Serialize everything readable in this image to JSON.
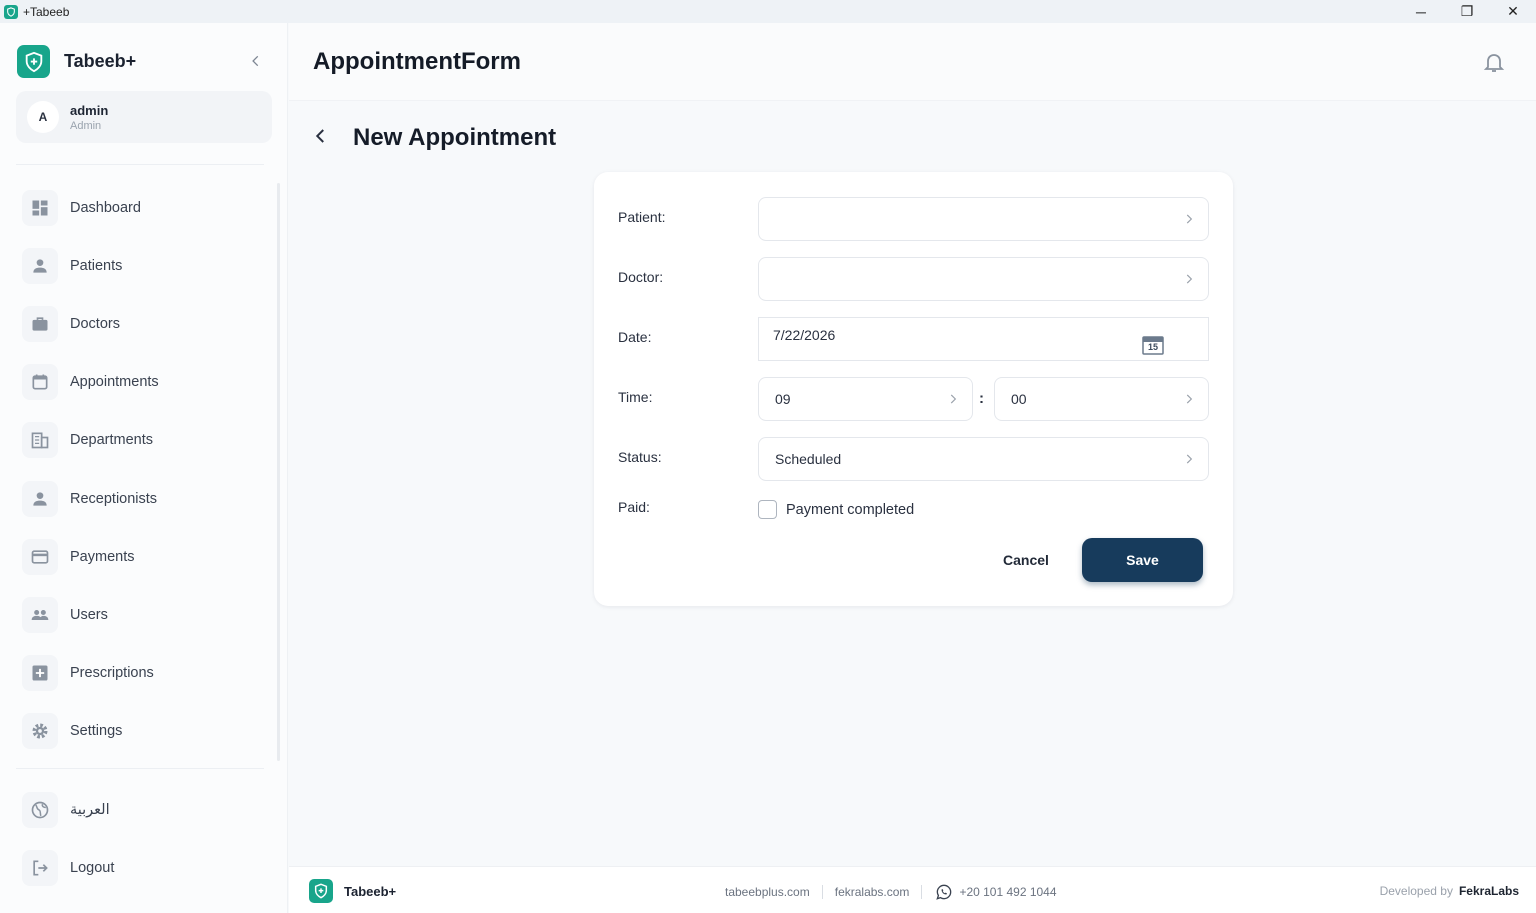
{
  "window": {
    "title": "+Tabeeb",
    "minimize": "─",
    "maximize": "❐",
    "close": "✕"
  },
  "sidebar": {
    "brand": "Tabeeb+",
    "user": {
      "initial": "A",
      "name": "admin",
      "role": "Admin"
    },
    "items": [
      {
        "label": "Dashboard",
        "icon": "dashboard-icon"
      },
      {
        "label": "Patients",
        "icon": "person-icon"
      },
      {
        "label": "Doctors",
        "icon": "briefcase-icon"
      },
      {
        "label": "Appointments",
        "icon": "calendar-icon"
      },
      {
        "label": "Departments",
        "icon": "building-icon"
      },
      {
        "label": "Receptionists",
        "icon": "person-icon"
      },
      {
        "label": "Payments",
        "icon": "credit-card-icon"
      },
      {
        "label": "Users",
        "icon": "group-icon"
      },
      {
        "label": "Prescriptions",
        "icon": "plus-box-icon"
      },
      {
        "label": "Settings",
        "icon": "gear-icon"
      }
    ],
    "bottom_items": [
      {
        "label": "العربية",
        "icon": "globe-icon"
      },
      {
        "label": "Logout",
        "icon": "logout-icon"
      }
    ]
  },
  "header": {
    "title": "AppointmentForm"
  },
  "form": {
    "title": "New Appointment",
    "patient_label": "Patient:",
    "patient_value": "",
    "doctor_label": "Doctor:",
    "doctor_value": "",
    "date_label": "Date:",
    "date_value": "7/22/2026",
    "calendar_day": "15",
    "time_label": "Time:",
    "time_hour": "09",
    "time_separator": ":",
    "time_minute": "00",
    "status_label": "Status:",
    "status_value": "Scheduled",
    "paid_label": "Paid:",
    "paid_checkbox_label": "Payment completed",
    "paid_checked": false,
    "cancel_label": "Cancel",
    "save_label": "Save"
  },
  "footer": {
    "brand": "Tabeeb+",
    "link1": "tabeebplus.com",
    "link2": "fekralabs.com",
    "phone": "+20 101 492 1044",
    "developed_by": "Developed by",
    "developer": "FekraLabs"
  },
  "colors": {
    "brand": "#18a58b",
    "primary_button": "#173b5c",
    "icon": "#8a939f"
  }
}
